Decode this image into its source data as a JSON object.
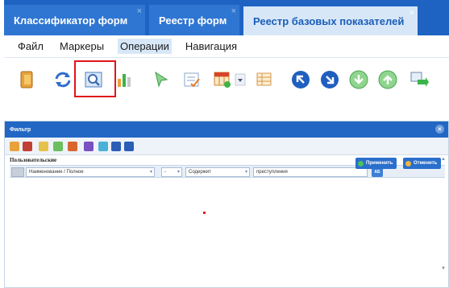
{
  "tabs": [
    {
      "label": "Классификатор форм",
      "close": "×"
    },
    {
      "label": "Реестр форм",
      "close": "×"
    },
    {
      "label": "Реестр базовых показателей",
      "close": "×"
    }
  ],
  "menu": {
    "items": [
      "Файл",
      "Маркеры",
      "Операции",
      "Навигация"
    ],
    "active": "Операции"
  },
  "toolbar": {
    "icons": [
      "folder-icon",
      "refresh-icon",
      "search-filter-icon",
      "bar-chart-icon",
      "cursor-icon",
      "edit-check-icon",
      "table-add-icon",
      "dropdown-arrow-icon",
      "table-icon",
      "nav-up-left-icon",
      "nav-down-right-icon",
      "arrow-down-icon",
      "arrow-up-icon",
      "export-icon"
    ],
    "colors": {
      "accent": "#1e63c2",
      "highlight_box": "#e0141a"
    }
  },
  "dialog": {
    "title": "Фильтр",
    "close": "×",
    "section_title": "Пользовательские",
    "scroll_up": "▲",
    "scroll_down": "▼",
    "filter_row": {
      "field": "Наименование / Полное",
      "dash": "-",
      "condition": "Содержит",
      "value": "преступления",
      "ab_label": "АБ"
    },
    "buttons": {
      "apply": "Применить",
      "cancel": "Отменить"
    }
  }
}
